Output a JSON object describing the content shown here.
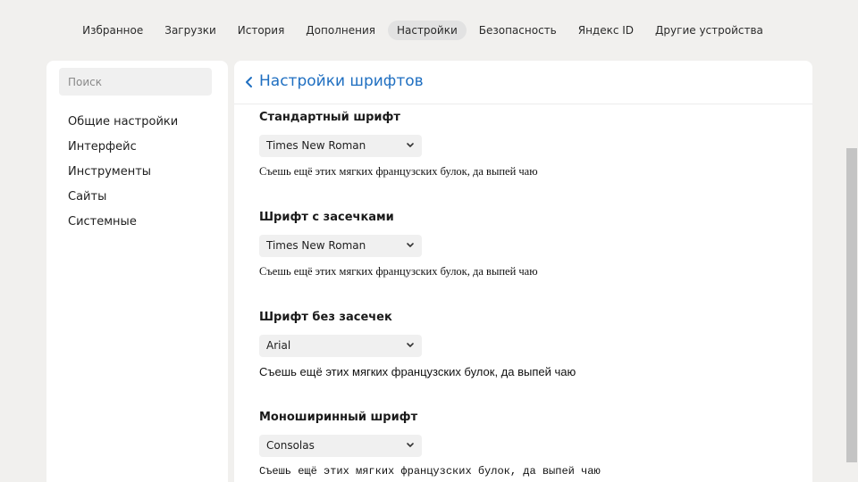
{
  "nav": {
    "tabs": [
      {
        "label": "Избранное"
      },
      {
        "label": "Загрузки"
      },
      {
        "label": "История"
      },
      {
        "label": "Дополнения"
      },
      {
        "label": "Настройки"
      },
      {
        "label": "Безопасность"
      },
      {
        "label": "Яндекс ID"
      },
      {
        "label": "Другие устройства"
      }
    ],
    "active_tab": "Настройки"
  },
  "sidebar": {
    "search_placeholder": "Поиск",
    "items": [
      {
        "label": "Общие настройки"
      },
      {
        "label": "Интерфейс"
      },
      {
        "label": "Инструменты"
      },
      {
        "label": "Сайты"
      },
      {
        "label": "Системные"
      }
    ]
  },
  "main": {
    "title": "Настройки шрифтов",
    "sections": [
      {
        "title": "Стандартный шрифт",
        "value": "Times New Roman",
        "preview": "Съешь ещё этих мягких французских булок, да выпей чаю"
      },
      {
        "title": "Шрифт с засечками",
        "value": "Times New Roman",
        "preview": "Съешь ещё этих мягких французских булок, да выпей чаю"
      },
      {
        "title": "Шрифт без засечек",
        "value": "Arial",
        "preview": "Съешь ещё этих мягких французских булок, да выпей чаю"
      },
      {
        "title": "Моноширинный шрифт",
        "value": "Consolas",
        "preview": "Съешь ещё этих мягких французских булок, да выпей чаю"
      }
    ]
  },
  "colors": {
    "accent": "#1f6fc1",
    "background": "#f1f0ee",
    "panel": "#ffffff"
  },
  "icons": {
    "back": "chevron-left-icon",
    "dropdown": "chevron-down-icon"
  }
}
